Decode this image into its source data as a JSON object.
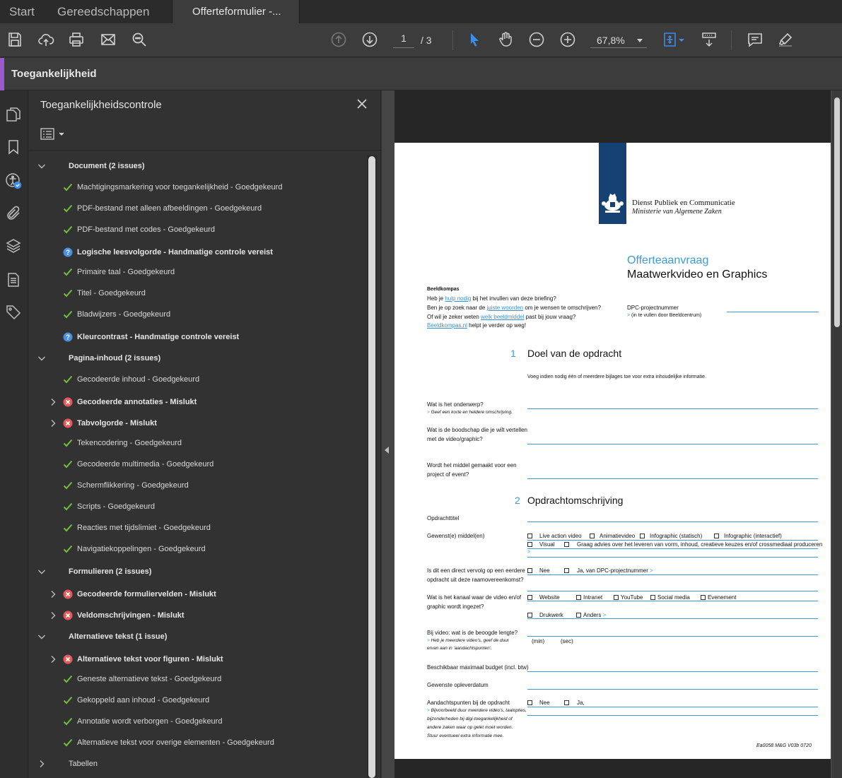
{
  "tabs": [
    {
      "label": "Start"
    },
    {
      "label": "Gereedschappen"
    },
    {
      "label": "Offerteformulier -..."
    }
  ],
  "toolbar": {
    "page_current": "1",
    "page_total": "/ 3",
    "zoom": "67,8%"
  },
  "header": {
    "title": "Toegankelijkheid"
  },
  "panel": {
    "title": "Toegankelijkheidscontrole",
    "rows": [
      {
        "label": "Document (2 issues)"
      },
      {
        "label": "Machtigingsmarkering voor toegankelijkheid - Goedgekeurd"
      },
      {
        "label": "PDF-bestand met alleen afbeeldingen - Goedgekeurd"
      },
      {
        "label": "PDF-bestand met codes - Goedgekeurd"
      },
      {
        "label": "Logische leesvolgorde - Handmatige controle vereist"
      },
      {
        "label": "Primaire taal - Goedgekeurd"
      },
      {
        "label": "Titel - Goedgekeurd"
      },
      {
        "label": "Bladwijzers - Goedgekeurd"
      },
      {
        "label": "Kleurcontrast - Handmatige controle vereist"
      },
      {
        "label": "Pagina-inhoud (2 issues)"
      },
      {
        "label": "Gecodeerde inhoud - Goedgekeurd"
      },
      {
        "label": "Gecodeerde annotaties - Mislukt"
      },
      {
        "label": "Tabvolgorde - Mislukt"
      },
      {
        "label": "Tekencodering - Goedgekeurd"
      },
      {
        "label": "Gecodeerde multimedia - Goedgekeurd"
      },
      {
        "label": "Schermflikkering - Goedgekeurd"
      },
      {
        "label": "Scripts - Goedgekeurd"
      },
      {
        "label": "Reacties met tijdslimiet - Goedgekeurd"
      },
      {
        "label": "Navigatiekoppelingen - Goedgekeurd"
      },
      {
        "label": "Formulieren (2 issues)"
      },
      {
        "label": "Gecodeerde formuliervelden - Mislukt"
      },
      {
        "label": "Veldomschrijvingen - Mislukt"
      },
      {
        "label": "Alternatieve tekst (1 issue)"
      },
      {
        "label": "Alternatieve tekst voor figuren - Mislukt"
      },
      {
        "label": "Geneste alternatieve tekst - Goedgekeurd"
      },
      {
        "label": "Gekoppeld aan inhoud - Goedgekeurd"
      },
      {
        "label": "Annotatie wordt verborgen - Goedgekeurd"
      },
      {
        "label": "Alternatieve tekst voor overige elementen - Goedgekeurd"
      },
      {
        "label": "Tabellen"
      }
    ]
  },
  "document": {
    "org_name": "Dienst Publiek en Communicatie",
    "org_sub": "Ministerie van Algemene Zaken",
    "form_title_1": "Offerteaanvraag",
    "form_title_2": "Maatwerkvideo en Graphics",
    "beeldkompas_title": "Beeldkompas",
    "bk_l1_a": "Heb je ",
    "bk_l1_link": "hulp nodig",
    "bk_l1_b": " bij het invullen van deze briefing?",
    "bk_l2_a": "Ben je op zoek naar de ",
    "bk_l2_link": "juiste woorden",
    "bk_l2_b": " om je wensen te omschrijven?",
    "bk_l3_a": "Of wil je zeker weten ",
    "bk_l3_link": "welk beeldmiddel",
    "bk_l3_b": " past bij jouw vraag?",
    "bk_l4_link": "Beeldkompas.nl",
    "bk_l4_b": " helpt je verder op weg!",
    "dpc_label": "DPC-projectnummer",
    "dpc_note": "(in te vullen door Beeldcentrum)",
    "s1_num": "1",
    "s1_title": "Doel van de opdracht",
    "s1_intro": "Voeg indien nodig één of meerdere bijlages toe voor extra inhoudelijke informatie.",
    "q_onderwerp": "Wat is het onderwerp?",
    "q_onderwerp_hint": "Geef een korte en heldere omschrijving.",
    "q_boodschap_1": "Wat is de boodschap die je wilt vertellen",
    "q_boodschap_2": "met de video/graphic?",
    "q_middel_1": "Wordt het middel gemaakt voor een",
    "q_middel_2": "project of event?",
    "s2_num": "2",
    "s2_title": "Opdrachtomschrijving",
    "q_titel": "Opdrachttitel",
    "q_gewenst": "Gewenst(e) middel(en)",
    "opt_live": "Live action video",
    "opt_animatie": "Animatievideo",
    "opt_info_stat": "Infographic (statisch)",
    "opt_info_inter": "Infographic (interactief)",
    "opt_visual": "Visual",
    "opt_advies": "Graag advies over het leveren van vorm, inhoud, creatieve keuzes en/of crossmediaal produceren",
    "q_vervolg_1": "Is dit een direct vervolg op een eerdere",
    "q_vervolg_2": "opdracht uit deze raamovereenkomst?",
    "opt_nee": "Nee",
    "opt_ja_dpc": "Ja, van DPC-projectnummer",
    "q_kanaal_1": "Wat is het kanaal waar de video en/of",
    "q_kanaal_2": "graphic wordt ingezet?",
    "opt_website": "Website",
    "opt_intranet": "Intranet",
    "opt_youtube": "YouTube",
    "opt_social": "Social media",
    "opt_evenement": "Evenement",
    "opt_drukwerk": "Drukwerk",
    "opt_anders": "Anders",
    "q_lengte": "Bij video: wat is de beoogde lengte?",
    "q_lengte_hint_1": "Heb je meerdere video's, geef de duur",
    "q_lengte_hint_2": "ervan aan in 'aandachtspunten'.",
    "unit_min": "(min)",
    "unit_sec": "(sec)",
    "q_budget": "Beschikbaar maximaal budget (incl. btw)",
    "q_datum": "Gewenste opleverdatum",
    "q_aandacht": "Aandachtspunten bij de opdracht",
    "q_aandacht_h1": "Bijvoorbeeld duur meerdere video's, taalopties,",
    "q_aandacht_h2": "bijzonderheden bij digi-toegankelijkheid of",
    "q_aandacht_h3": "andere zaken waar op gelet moet worden.",
    "q_aandacht_h4": "Stuur eventueel extra informatie mee.",
    "opt_ja": "Ja,",
    "footer_code": "Ea0058 M&G V03b 0720"
  }
}
